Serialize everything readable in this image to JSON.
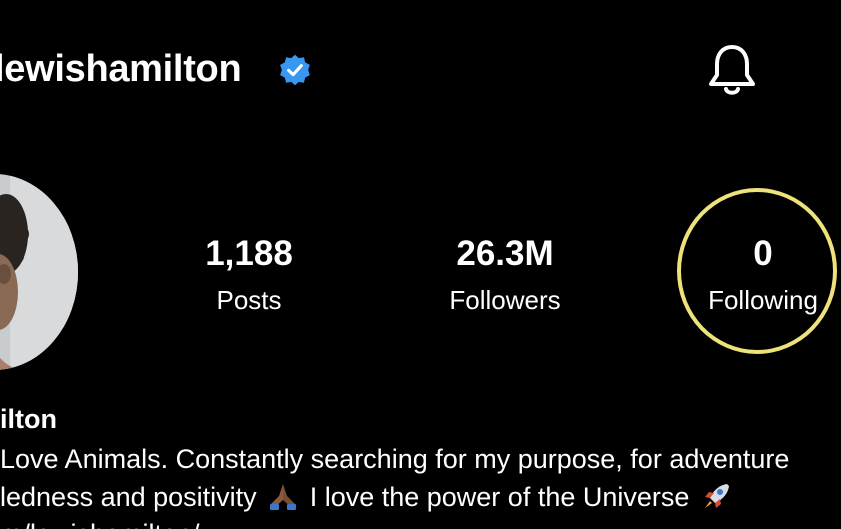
{
  "header": {
    "username": "lewishamilton",
    "verified_icon": "verified-badge-icon",
    "bell_icon": "bell-icon"
  },
  "profile": {
    "avatar_icon": "profile-picture"
  },
  "stats": {
    "posts": {
      "value": "1,188",
      "label": "Posts"
    },
    "followers": {
      "value": "26.3M",
      "label": "Followers"
    },
    "following": {
      "value": "0",
      "label": "Following"
    }
  },
  "bio": {
    "name": "ilton",
    "line1": "Love Animals. Constantly searching for my purpose, for adventure",
    "line2_a": "ledness and positivity",
    "line2_b": "I love the power of the Universe",
    "line3": "m/lewishamilton/"
  },
  "colors": {
    "background": "#000000",
    "text": "#ffffff",
    "verified": "#3897f0",
    "highlight": "#eee27a"
  }
}
